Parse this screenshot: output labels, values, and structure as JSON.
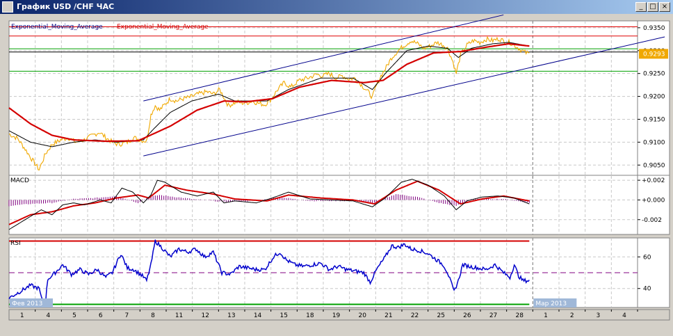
{
  "window": {
    "title": "График USD /CHF ЧАС",
    "min_glyph": "_",
    "max_glyph": "□",
    "close_glyph": "×"
  },
  "legend": {
    "ema1": "Exponential_Moving_Average",
    "ema2": "Exponential_Moving_Average"
  },
  "current_price": "0.9293",
  "colors": {
    "price": "#f0a800",
    "ema_fast": "#000000",
    "ema_slow": "#d40000",
    "channel": "#00008b",
    "resistance": "#e00000",
    "support": "#00a000",
    "macd": "#000000",
    "signal": "#d40000",
    "hist": "#800080",
    "rsi": "#0000cc",
    "rsi_upper": "#d40000",
    "rsi_lower": "#00a000",
    "rsi_mid": "#800080",
    "price_tag": "#f0a800"
  },
  "chart_data": [
    {
      "type": "line",
      "name": "price",
      "y_range": [
        0.902,
        0.9365
      ],
      "y_ticks": [
        "0.9350",
        "0.9300",
        "0.9250",
        "0.9200",
        "0.9150",
        "0.9100",
        "0.9050"
      ],
      "y_tick_values": [
        0.935,
        0.93,
        0.925,
        0.92,
        0.915,
        0.91,
        0.905
      ],
      "price_anchors": [
        [
          0,
          0.9118
        ],
        [
          8,
          0.9108
        ],
        [
          15,
          0.9085
        ],
        [
          22,
          0.906
        ],
        [
          28,
          0.904
        ],
        [
          34,
          0.9075
        ],
        [
          40,
          0.9095
        ],
        [
          48,
          0.9105
        ],
        [
          55,
          0.911
        ],
        [
          62,
          0.91
        ],
        [
          70,
          0.9105
        ],
        [
          78,
          0.9115
        ],
        [
          84,
          0.9122
        ],
        [
          90,
          0.911
        ],
        [
          96,
          0.91
        ],
        [
          102,
          0.9095
        ],
        [
          110,
          0.91
        ],
        [
          116,
          0.911
        ],
        [
          122,
          0.9105
        ],
        [
          128,
          0.9102
        ],
        [
          132,
          0.916
        ],
        [
          136,
          0.918
        ],
        [
          140,
          0.917
        ],
        [
          146,
          0.9185
        ],
        [
          150,
          0.9195
        ],
        [
          156,
          0.919
        ],
        [
          162,
          0.9195
        ],
        [
          168,
          0.9198
        ],
        [
          176,
          0.9205
        ],
        [
          184,
          0.921
        ],
        [
          190,
          0.9205
        ],
        [
          196,
          0.9215
        ],
        [
          204,
          0.918
        ],
        [
          212,
          0.9188
        ],
        [
          220,
          0.9185
        ],
        [
          226,
          0.919
        ],
        [
          232,
          0.9185
        ],
        [
          238,
          0.9182
        ],
        [
          244,
          0.9195
        ],
        [
          250,
          0.9215
        ],
        [
          256,
          0.923
        ],
        [
          262,
          0.922
        ],
        [
          270,
          0.9235
        ],
        [
          278,
          0.924
        ],
        [
          286,
          0.9248
        ],
        [
          292,
          0.9245
        ],
        [
          298,
          0.925
        ],
        [
          304,
          0.924
        ],
        [
          310,
          0.9245
        ],
        [
          316,
          0.9238
        ],
        [
          322,
          0.924
        ],
        [
          328,
          0.9225
        ],
        [
          334,
          0.921
        ],
        [
          338,
          0.9198
        ],
        [
          342,
          0.9225
        ],
        [
          346,
          0.9245
        ],
        [
          350,
          0.926
        ],
        [
          356,
          0.9285
        ],
        [
          362,
          0.93
        ],
        [
          368,
          0.9312
        ],
        [
          374,
          0.9322
        ],
        [
          380,
          0.9315
        ],
        [
          386,
          0.9305
        ],
        [
          392,
          0.931
        ],
        [
          398,
          0.9318
        ],
        [
          404,
          0.9312
        ],
        [
          408,
          0.9305
        ],
        [
          413,
          0.9275
        ],
        [
          416,
          0.925
        ],
        [
          420,
          0.929
        ],
        [
          426,
          0.9312
        ],
        [
          432,
          0.9322
        ],
        [
          438,
          0.9318
        ],
        [
          444,
          0.9325
        ],
        [
          450,
          0.9322
        ],
        [
          456,
          0.9326
        ],
        [
          462,
          0.9318
        ],
        [
          466,
          0.9318
        ],
        [
          470,
          0.9312
        ],
        [
          476,
          0.9302
        ],
        [
          480,
          0.9296
        ],
        [
          484,
          0.9293
        ]
      ],
      "ema_fast_anchors": [
        [
          0,
          0.9125
        ],
        [
          20,
          0.91
        ],
        [
          40,
          0.909
        ],
        [
          60,
          0.91
        ],
        [
          80,
          0.9105
        ],
        [
          100,
          0.91
        ],
        [
          125,
          0.9105
        ],
        [
          135,
          0.913
        ],
        [
          150,
          0.9165
        ],
        [
          170,
          0.919
        ],
        [
          195,
          0.9205
        ],
        [
          210,
          0.919
        ],
        [
          240,
          0.919
        ],
        [
          260,
          0.9215
        ],
        [
          290,
          0.924
        ],
        [
          320,
          0.924
        ],
        [
          338,
          0.9215
        ],
        [
          350,
          0.925
        ],
        [
          370,
          0.93
        ],
        [
          390,
          0.931
        ],
        [
          408,
          0.9305
        ],
        [
          418,
          0.9285
        ],
        [
          430,
          0.9305
        ],
        [
          450,
          0.9315
        ],
        [
          465,
          0.9318
        ],
        [
          484,
          0.931
        ]
      ],
      "ema_slow_anchors": [
        [
          0,
          0.9175
        ],
        [
          20,
          0.914
        ],
        [
          40,
          0.9115
        ],
        [
          60,
          0.9105
        ],
        [
          90,
          0.9102
        ],
        [
          120,
          0.9103
        ],
        [
          150,
          0.9135
        ],
        [
          175,
          0.917
        ],
        [
          200,
          0.919
        ],
        [
          220,
          0.9188
        ],
        [
          245,
          0.9195
        ],
        [
          270,
          0.922
        ],
        [
          300,
          0.9235
        ],
        [
          330,
          0.923
        ],
        [
          348,
          0.9235
        ],
        [
          370,
          0.927
        ],
        [
          395,
          0.9295
        ],
        [
          420,
          0.9298
        ],
        [
          445,
          0.9308
        ],
        [
          465,
          0.9315
        ],
        [
          484,
          0.931
        ]
      ],
      "channel_upper": [
        [
          125,
          0.919
        ],
        [
          460,
          0.9378
        ]
      ],
      "channel_lower": [
        [
          125,
          0.907
        ],
        [
          610,
          0.933
        ]
      ],
      "resistance_levels": [
        0.9352,
        0.9332
      ],
      "support_levels": [
        0.9304,
        0.9255
      ],
      "zero_level": 0.9297
    },
    {
      "type": "line",
      "name": "MACD",
      "title": "MACD",
      "y_range": [
        -0.0035,
        0.0025
      ],
      "y_ticks": [
        "+0.002",
        "+0.000",
        "-0.002"
      ],
      "y_tick_values": [
        0.002,
        0,
        -0.002
      ],
      "macd_anchors": [
        [
          0,
          -0.003
        ],
        [
          15,
          -0.002
        ],
        [
          30,
          -0.001
        ],
        [
          40,
          -0.0015
        ],
        [
          50,
          -0.0005
        ],
        [
          60,
          -0.0003
        ],
        [
          70,
          -0.0005
        ],
        [
          85,
          0.0
        ],
        [
          95,
          -0.0003
        ],
        [
          105,
          0.0012
        ],
        [
          115,
          0.0008
        ],
        [
          125,
          -0.0003
        ],
        [
          132,
          0.0005
        ],
        [
          138,
          0.002
        ],
        [
          145,
          0.0018
        ],
        [
          160,
          0.0008
        ],
        [
          175,
          0.0004
        ],
        [
          190,
          0.0008
        ],
        [
          200,
          -0.0003
        ],
        [
          210,
          -0.0001
        ],
        [
          230,
          -0.0003
        ],
        [
          245,
          0.0002
        ],
        [
          260,
          0.0008
        ],
        [
          280,
          0.0001
        ],
        [
          300,
          0.0
        ],
        [
          320,
          -0.0001
        ],
        [
          338,
          -0.0007
        ],
        [
          350,
          0.0002
        ],
        [
          365,
          0.0018
        ],
        [
          375,
          0.0021
        ],
        [
          390,
          0.0015
        ],
        [
          405,
          0.0004
        ],
        [
          416,
          -0.001
        ],
        [
          426,
          -0.0001
        ],
        [
          440,
          0.0003
        ],
        [
          455,
          0.0004
        ],
        [
          470,
          0.0002
        ],
        [
          484,
          -0.0004
        ]
      ],
      "signal_anchors": [
        [
          0,
          -0.0025
        ],
        [
          20,
          -0.0015
        ],
        [
          40,
          -0.0012
        ],
        [
          60,
          -0.0006
        ],
        [
          80,
          -0.0003
        ],
        [
          100,
          0.0002
        ],
        [
          120,
          0.0005
        ],
        [
          130,
          0.0002
        ],
        [
          145,
          0.0015
        ],
        [
          165,
          0.001
        ],
        [
          190,
          0.0006
        ],
        [
          210,
          0.0001
        ],
        [
          240,
          -0.0001
        ],
        [
          260,
          0.0005
        ],
        [
          290,
          0.0002
        ],
        [
          320,
          0.0
        ],
        [
          340,
          -0.0004
        ],
        [
          360,
          0.001
        ],
        [
          380,
          0.0019
        ],
        [
          400,
          0.001
        ],
        [
          420,
          -0.0004
        ],
        [
          440,
          0.0001
        ],
        [
          460,
          0.0004
        ],
        [
          484,
          -0.0001
        ]
      ],
      "hist_anchors": [
        [
          0,
          -0.0006
        ],
        [
          20,
          -0.0004
        ],
        [
          40,
          -0.0003
        ],
        [
          60,
          0.0001
        ],
        [
          80,
          0.0002
        ],
        [
          100,
          0.0004
        ],
        [
          120,
          -0.0003
        ],
        [
          130,
          0.0003
        ],
        [
          140,
          0.0005
        ],
        [
          170,
          0.0001
        ],
        [
          200,
          -0.0002
        ],
        [
          230,
          -0.0001
        ],
        [
          250,
          0.0003
        ],
        [
          280,
          -0.0001
        ],
        [
          320,
          -0.0001
        ],
        [
          340,
          -0.0003
        ],
        [
          360,
          0.0006
        ],
        [
          380,
          0.0003
        ],
        [
          400,
          -0.0003
        ],
        [
          416,
          -0.0006
        ],
        [
          430,
          0.0001
        ],
        [
          460,
          0.0001
        ],
        [
          484,
          -0.0003
        ]
      ]
    },
    {
      "type": "line",
      "name": "RSI",
      "title": "RSI",
      "y_range": [
        28,
        72
      ],
      "y_ticks": [
        "60",
        "40"
      ],
      "y_tick_values": [
        60,
        40
      ],
      "upper_level": 70,
      "lower_level": 30,
      "mid_level": 50,
      "rsi_anchors": [
        [
          0,
          34
        ],
        [
          10,
          38
        ],
        [
          20,
          42
        ],
        [
          28,
          40
        ],
        [
          30,
          34
        ],
        [
          34,
          32
        ],
        [
          36,
          46
        ],
        [
          40,
          48
        ],
        [
          50,
          55
        ],
        [
          58,
          49
        ],
        [
          66,
          52
        ],
        [
          74,
          49
        ],
        [
          82,
          52
        ],
        [
          90,
          47
        ],
        [
          96,
          50
        ],
        [
          104,
          62
        ],
        [
          110,
          53
        ],
        [
          116,
          52
        ],
        [
          124,
          48
        ],
        [
          128,
          45
        ],
        [
          132,
          55
        ],
        [
          136,
          70
        ],
        [
          142,
          66
        ],
        [
          150,
          60
        ],
        [
          158,
          65
        ],
        [
          166,
          63
        ],
        [
          174,
          65
        ],
        [
          182,
          60
        ],
        [
          190,
          63
        ],
        [
          198,
          50
        ],
        [
          206,
          49
        ],
        [
          214,
          54
        ],
        [
          222,
          53
        ],
        [
          230,
          52
        ],
        [
          238,
          52
        ],
        [
          246,
          60
        ],
        [
          252,
          63
        ],
        [
          258,
          58
        ],
        [
          266,
          55
        ],
        [
          274,
          54
        ],
        [
          282,
          55
        ],
        [
          290,
          56
        ],
        [
          298,
          52
        ],
        [
          306,
          54
        ],
        [
          314,
          52
        ],
        [
          322,
          51
        ],
        [
          330,
          50
        ],
        [
          336,
          44
        ],
        [
          342,
          52
        ],
        [
          350,
          60
        ],
        [
          356,
          67
        ],
        [
          362,
          66
        ],
        [
          368,
          68
        ],
        [
          374,
          65
        ],
        [
          382,
          64
        ],
        [
          390,
          62
        ],
        [
          398,
          58
        ],
        [
          404,
          55
        ],
        [
          408,
          50
        ],
        [
          414,
          38
        ],
        [
          418,
          45
        ],
        [
          422,
          55
        ],
        [
          428,
          54
        ],
        [
          436,
          53
        ],
        [
          444,
          52
        ],
        [
          452,
          55
        ],
        [
          460,
          50
        ],
        [
          466,
          47
        ],
        [
          470,
          55
        ],
        [
          474,
          48
        ],
        [
          478,
          45
        ],
        [
          484,
          45
        ]
      ]
    }
  ],
  "x_axis": {
    "start_month": "Фев 2013",
    "next_month": "Мар 2013",
    "labels": [
      "1",
      "4",
      "5",
      "6",
      "7",
      "8",
      "11",
      "12",
      "13",
      "14",
      "15",
      "18",
      "19",
      "20",
      "21",
      "22",
      "25",
      "26",
      "27",
      "28",
      "1",
      "2",
      "3",
      "4"
    ],
    "total_days": 24,
    "data_days": 20
  }
}
